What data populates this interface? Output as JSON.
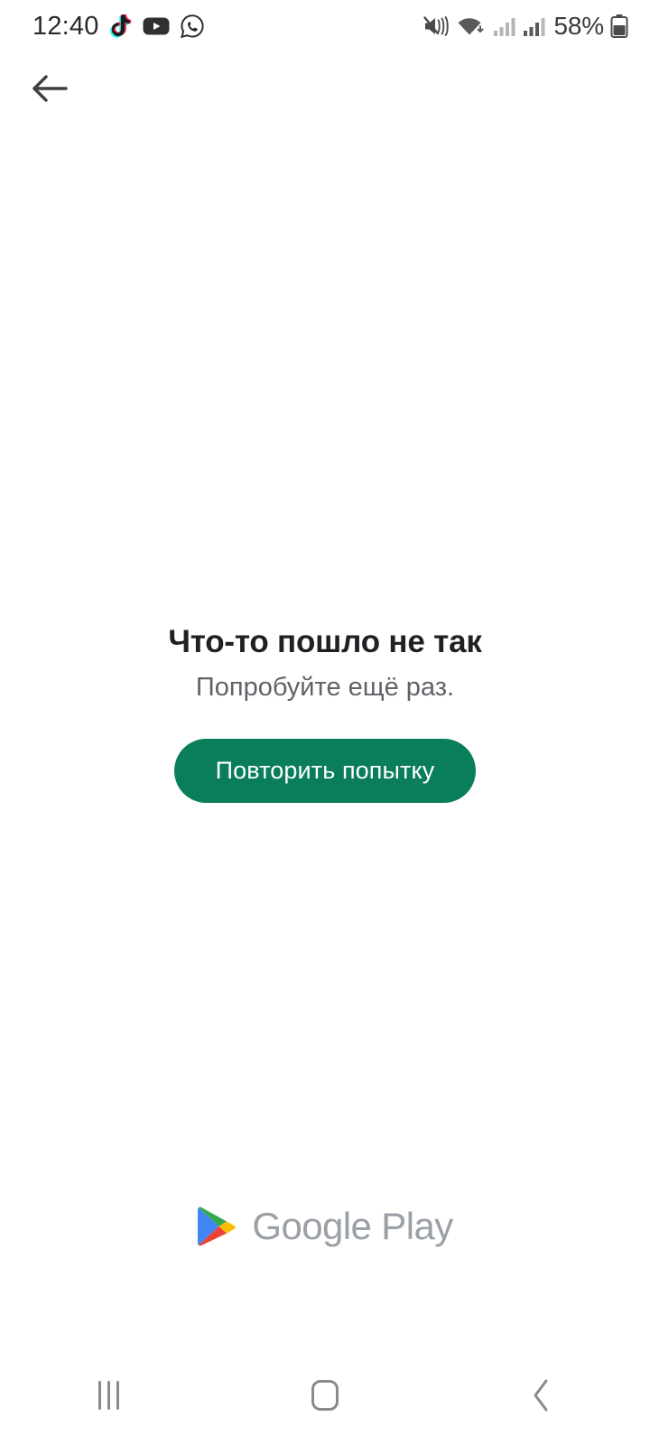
{
  "status_bar": {
    "time": "12:40",
    "battery_percent": "58%",
    "notification_icons": [
      "tiktok-icon",
      "youtube-icon",
      "whatsapp-icon"
    ],
    "system_icons": [
      "mute-vibrate-icon",
      "wifi-icon",
      "signal-bars-icon",
      "signal-bars-2-icon",
      "battery-icon"
    ]
  },
  "app_bar": {
    "back_icon": "arrow-left-icon"
  },
  "error": {
    "title": "Что-то пошло не так",
    "subtitle": "Попробуйте ещё раз.",
    "retry_label": "Повторить попытку"
  },
  "brand": {
    "name": "Google Play",
    "logo_icon": "google-play-triangle-icon"
  },
  "nav_bar": {
    "recents_label": "recents-icon",
    "home_label": "home-icon",
    "back_label": "back-icon"
  },
  "colors": {
    "accent_green": "#0a7d5a",
    "title_text": "#1f2124",
    "subtitle_text": "#5f6368",
    "brand_text": "#9aa0a6",
    "nav_icon": "#8a8a8a",
    "background": "#ffffff"
  }
}
